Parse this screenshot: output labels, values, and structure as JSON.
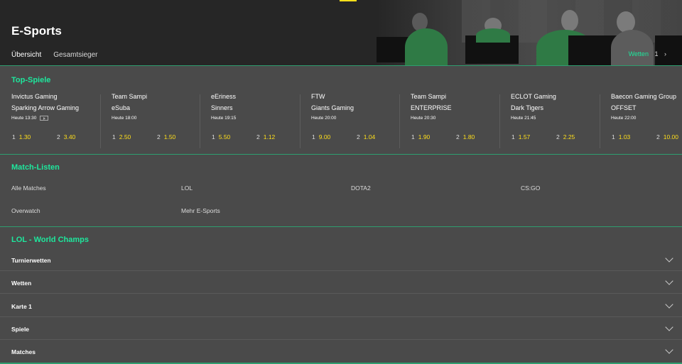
{
  "header": {
    "title": "E-Sports",
    "tabs": [
      {
        "label": "Übersicht",
        "active": true
      },
      {
        "label": "Gesamtsieger",
        "active": false
      }
    ],
    "wetten_label": "Wetten",
    "wetten_count": "1",
    "chevron": "›"
  },
  "colors": {
    "accent_green": "#1ee79d",
    "odds_yellow": "#ffdf1b",
    "header_bg": "#262626",
    "page_bg": "#4a4a4a"
  },
  "top_games": {
    "title": "Top-Spiele",
    "matches": [
      {
        "team1": "Invictus Gaming",
        "team2": "Sparking Arrow Gaming",
        "time": "Heute 13:30",
        "live_tv": true,
        "odd1_label": "1",
        "odd1": "1.30",
        "odd2_label": "2",
        "odd2": "3.40"
      },
      {
        "team1": "Team Sampi",
        "team2": "eSuba",
        "time": "Heute 18:00",
        "live_tv": false,
        "odd1_label": "1",
        "odd1": "2.50",
        "odd2_label": "2",
        "odd2": "1.50"
      },
      {
        "team1": "eEriness",
        "team2": "Sinners",
        "time": "Heute 19:15",
        "live_tv": false,
        "odd1_label": "1",
        "odd1": "5.50",
        "odd2_label": "2",
        "odd2": "1.12"
      },
      {
        "team1": "FTW",
        "team2": "Giants Gaming",
        "time": "Heute 20:00",
        "live_tv": false,
        "odd1_label": "1",
        "odd1": "9.00",
        "odd2_label": "2",
        "odd2": "1.04"
      },
      {
        "team1": "Team Sampi",
        "team2": "ENTERPRISE",
        "time": "Heute 20:30",
        "live_tv": false,
        "odd1_label": "1",
        "odd1": "1.90",
        "odd2_label": "2",
        "odd2": "1.80"
      },
      {
        "team1": "ECLOT Gaming",
        "team2": "Dark Tigers",
        "time": "Heute 21:45",
        "live_tv": false,
        "odd1_label": "1",
        "odd1": "1.57",
        "odd2_label": "2",
        "odd2": "2.25"
      },
      {
        "team1": "Baecon Gaming Group",
        "team2": "OFFSET",
        "time": "Heute 22:00",
        "live_tv": false,
        "odd1_label": "1",
        "odd1": "1.03",
        "odd2_label": "2",
        "odd2": "10.00"
      }
    ]
  },
  "match_lists": {
    "title": "Match-Listen",
    "links": [
      "Alle Matches",
      "LOL",
      "DOTA2",
      "CS:GO",
      "Overwatch",
      "Mehr E-Sports"
    ]
  },
  "lol": {
    "title": "LOL - World Champs",
    "rows": [
      "Turnierwetten",
      "Wetten",
      "Karte 1",
      "Spiele",
      "Matches"
    ]
  }
}
